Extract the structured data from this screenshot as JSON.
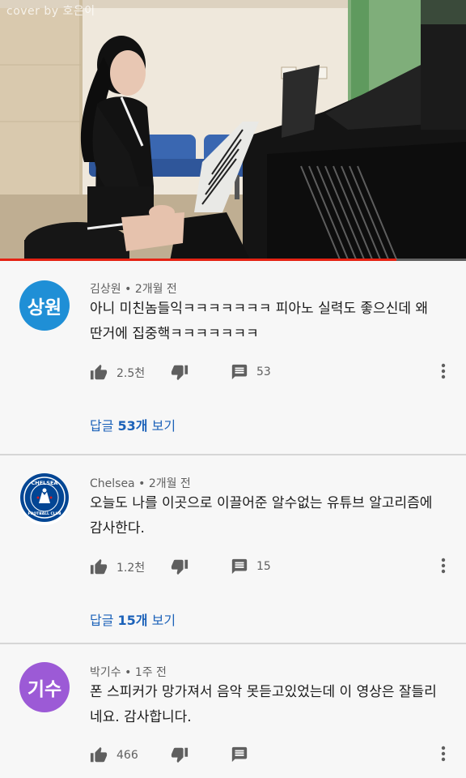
{
  "video": {
    "watermark": "cover by 호은이",
    "progress": 0.85,
    "accent": "#e52213"
  },
  "comments": [
    {
      "author": "김상원",
      "time": "2개월 전",
      "avatar_text": "상원",
      "avatar_color": "#1f8fd6",
      "lines": [
        "아니 미친놈들익ㅋㅋㅋㅋㅋㅋㅋ 피아노 실력도 좋으신데 왜",
        "딴거에 집중핵ㅋㅋㅋㅋㅋㅋㅋ"
      ],
      "likes": "2.5천",
      "replies": "53",
      "view_replies_prefix": "답글 ",
      "view_replies_count": "53개",
      "view_replies_suffix": " 보기"
    },
    {
      "author": "Chelsea",
      "time": "2개월 전",
      "avatar_icon": "chelsea-crest-icon",
      "avatar_color": "#034694",
      "lines": [
        "오늘도 나를 이곳으로 이끌어준 알수없는 유튜브 알고리즘에",
        "감사한다."
      ],
      "likes": "1.2천",
      "replies": "15",
      "view_replies_prefix": "답글 ",
      "view_replies_count": "15개",
      "view_replies_suffix": " 보기"
    },
    {
      "author": "박기수",
      "time": "1주 전",
      "avatar_text": "기수",
      "avatar_color": "#9c5ad6",
      "lines": [
        "폰 스피커가 망가져서 음악 못듣고있었는데 이 영상은 잘들리",
        "네요. 감사합니다."
      ],
      "likes": "466",
      "replies": ""
    }
  ],
  "icons": {
    "like": "thumbs-up-icon",
    "dislike": "thumbs-down-icon",
    "reply": "comment-icon",
    "more": "more-vert-icon"
  },
  "sep": "•"
}
